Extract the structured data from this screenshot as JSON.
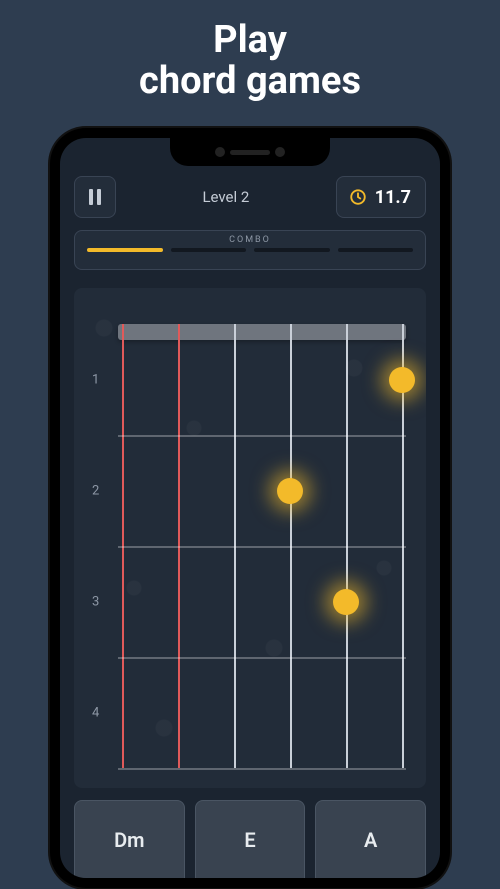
{
  "promo": {
    "line1": "Play",
    "line2": "chord games"
  },
  "header": {
    "level_label": "Level 2",
    "timer_value": "11.7"
  },
  "combo": {
    "label": "COMBO",
    "filled_segments": 1,
    "total_segments": 4
  },
  "fretboard": {
    "fret_numbers": [
      "1",
      "2",
      "3",
      "4"
    ],
    "muted_strings": [
      1,
      2
    ],
    "finger_positions": [
      {
        "string": 6,
        "fret": 1
      },
      {
        "string": 4,
        "fret": 2
      },
      {
        "string": 5,
        "fret": 3
      }
    ]
  },
  "chords": {
    "options": [
      "Dm",
      "E",
      "A"
    ]
  },
  "colors": {
    "accent": "#f3ba2a",
    "muted_string": "#e05a5a",
    "bg": "#1b2430"
  }
}
